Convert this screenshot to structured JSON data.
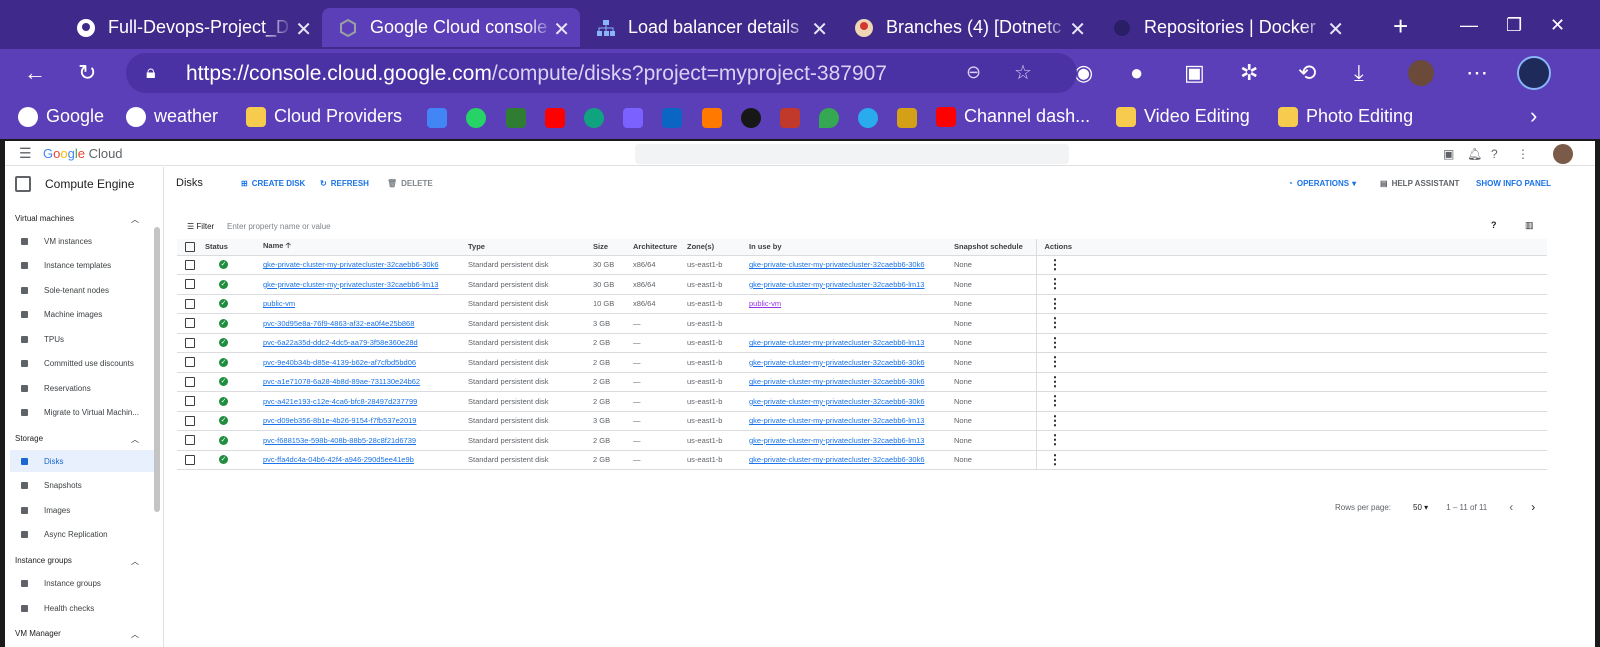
{
  "browser": {
    "tabs": [
      {
        "title": "Full-Devops-Project_D",
        "icon": "github-icon"
      },
      {
        "title": "Google Cloud console",
        "icon": "google-cloud-icon"
      },
      {
        "title": "Load balancer details",
        "icon": "load-balancer-icon"
      },
      {
        "title": "Branches (4) [Dotnetc",
        "icon": "jenkins-icon"
      },
      {
        "title": "Repositories | Docker",
        "icon": "docker-icon"
      }
    ],
    "url_host": "https://console.cloud.google.com",
    "url_path": "/compute/disks?project=myproject-387907",
    "bookmarks": [
      {
        "label": "Google"
      },
      {
        "label": "weather"
      },
      {
        "label": "Cloud Providers"
      },
      {
        "label": "Channel dash..."
      },
      {
        "label": "Video Editing"
      },
      {
        "label": "Photo Editing"
      }
    ],
    "bookmark_colors": [
      "#4285f4",
      "#25d366",
      "#2e7d32",
      "#ff0000",
      "#10a37f",
      "#7b61ff",
      "#0a66c2",
      "#ff7900",
      "#181717",
      "#c0392b",
      "#34a853",
      "#2aabee",
      "#d4a017"
    ]
  },
  "console": {
    "logo": {
      "g": "G",
      "o1": "o",
      "o2": "o",
      "g2": "g",
      "l": "l",
      "e": "e",
      "cloud": " Cloud"
    },
    "service": "Compute Engine",
    "sidebar": {
      "sections": [
        {
          "label": "Virtual machines"
        },
        {
          "label": "Storage"
        },
        {
          "label": "Instance groups"
        },
        {
          "label": "VM Manager"
        }
      ],
      "items": [
        {
          "label": "VM instances"
        },
        {
          "label": "Instance templates"
        },
        {
          "label": "Sole-tenant nodes"
        },
        {
          "label": "Machine images"
        },
        {
          "label": "TPUs"
        },
        {
          "label": "Committed use discounts"
        },
        {
          "label": "Reservations"
        },
        {
          "label": "Migrate to Virtual Machin..."
        },
        {
          "label": "Disks"
        },
        {
          "label": "Snapshots"
        },
        {
          "label": "Images"
        },
        {
          "label": "Async Replication"
        },
        {
          "label": "Instance groups"
        },
        {
          "label": "Health checks"
        }
      ]
    },
    "page": {
      "title": "Disks",
      "create": "CREATE DISK",
      "refresh": "REFRESH",
      "delete": "DELETE",
      "operations": "OPERATIONS",
      "help": "HELP ASSISTANT",
      "info": "SHOW INFO PANEL",
      "filter_label": "Filter",
      "filter_placeholder": "Enter property name or value"
    },
    "table": {
      "headers": [
        "Status",
        "Name",
        "Type",
        "Size",
        "Architecture",
        "Zone(s)",
        "In use by",
        "Snapshot schedule",
        "Actions"
      ],
      "rows": [
        [
          "gke-private-cluster-my-privatecluster-32caebb6-30k6",
          "Standard persistent disk",
          "30 GB",
          "x86/64",
          "us-east1-b",
          "gke-private-cluster-my-privatecluster-32caebb6-30k6",
          "None"
        ],
        [
          "gke-private-cluster-my-privatecluster-32caebb6-lm13",
          "Standard persistent disk",
          "30 GB",
          "x86/64",
          "us-east1-b",
          "gke-private-cluster-my-privatecluster-32caebb6-lm13",
          "None"
        ],
        [
          "public-vm",
          "Standard persistent disk",
          "10 GB",
          "x86/64",
          "us-east1-b",
          "public-vm",
          "None"
        ],
        [
          "pvc-30d95e8a-76f9-4863-af32-ea0f4e25b868",
          "Standard persistent disk",
          "3 GB",
          "—",
          "us-east1-b",
          "",
          "None"
        ],
        [
          "pvc-6a22a35d-ddc2-4dc5-aa79-3f58e360e28d",
          "Standard persistent disk",
          "2 GB",
          "—",
          "us-east1-b",
          "gke-private-cluster-my-privatecluster-32caebb6-lm13",
          "None"
        ],
        [
          "pvc-9e40b34b-d85e-4139-b62e-af7cfbd5bd06",
          "Standard persistent disk",
          "2 GB",
          "—",
          "us-east1-b",
          "gke-private-cluster-my-privatecluster-32caebb6-30k6",
          "None"
        ],
        [
          "pvc-a1e71078-6a28-4b8d-89ae-731130e24b62",
          "Standard persistent disk",
          "2 GB",
          "—",
          "us-east1-b",
          "gke-private-cluster-my-privatecluster-32caebb6-30k6",
          "None"
        ],
        [
          "pvc-a421e193-c12e-4ca6-bfc8-28497d237799",
          "Standard persistent disk",
          "2 GB",
          "—",
          "us-east1-b",
          "gke-private-cluster-my-privatecluster-32caebb6-30k6",
          "None"
        ],
        [
          "pvc-d09eb356-8b1e-4b26-9154-f7fb537e2019",
          "Standard persistent disk",
          "3 GB",
          "—",
          "us-east1-b",
          "gke-private-cluster-my-privatecluster-32caebb6-lm13",
          "None"
        ],
        [
          "pvc-f688153e-598b-408b-88b5-28c8f21d6739",
          "Standard persistent disk",
          "2 GB",
          "—",
          "us-east1-b",
          "gke-private-cluster-my-privatecluster-32caebb6-lm13",
          "None"
        ],
        [
          "pvc-ffa4dc4a-04b6-42f4-a946-290d5ee41e9b",
          "Standard persistent disk",
          "2 GB",
          "—",
          "us-east1-b",
          "gke-private-cluster-my-privatecluster-32caebb6-30k6",
          "None"
        ]
      ]
    },
    "pager": {
      "label": "Rows per page:",
      "value": "50",
      "range": "1 – 11 of 11"
    }
  }
}
